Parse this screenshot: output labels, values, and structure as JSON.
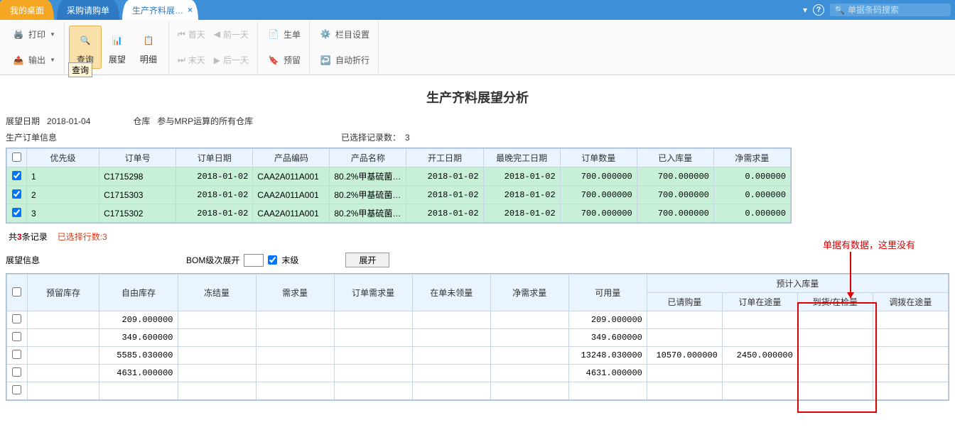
{
  "tabs": {
    "desktop": "我的桌面",
    "purchase": "采购请购单",
    "active": "生产齐料展…",
    "close": "×"
  },
  "titlebar": {
    "search_placeholder": "单据条码搜索",
    "help": "?",
    "dropdown": "▾"
  },
  "ribbon": {
    "print": "打印",
    "output": "输出",
    "query": "查询",
    "query_tip": "查询",
    "outlook": "展望",
    "detail": "明细",
    "firstday": "首天",
    "prevday": "前一天",
    "lastday": "末天",
    "nextday": "后一天",
    "makeorder": "生单",
    "reserve": "预留",
    "colset": "栏目设置",
    "wrap": "自动折行"
  },
  "page": {
    "title": "生产齐料展望分析",
    "date_label": "展望日期",
    "date_val": "2018-01-04",
    "wh_label": "仓库",
    "wh_val": "参与MRP运算的所有仓库",
    "order_info": "生产订单信息",
    "sel_label": "已选择记录数：",
    "sel_count": "3",
    "total_pre": "共",
    "total_n": "3",
    "total_suf": "条记录",
    "sel_rows": "已选择行数:3",
    "outlook_info": "展望信息",
    "bom_label": "BOM级次展开",
    "end_level": "末级",
    "expand_btn": "展开"
  },
  "t1": {
    "cols": [
      "优先级",
      "订单号",
      "订单日期",
      "产品编码",
      "产品名称",
      "开工日期",
      "最晚完工日期",
      "订单数量",
      "已入库量",
      "净需求量"
    ],
    "rows": [
      {
        "p": "1",
        "o": "C1715298",
        "d": "2018-01-02",
        "pc": "CAA2A011A001",
        "pn": "80.2%甲基硫菌…",
        "s": "2018-01-02",
        "e": "2018-01-02",
        "q": "700.000000",
        "in": "700.000000",
        "net": "0.000000"
      },
      {
        "p": "2",
        "o": "C1715303",
        "d": "2018-01-02",
        "pc": "CAA2A011A001",
        "pn": "80.2%甲基硫菌…",
        "s": "2018-01-02",
        "e": "2018-01-02",
        "q": "700.000000",
        "in": "700.000000",
        "net": "0.000000"
      },
      {
        "p": "3",
        "o": "C1715302",
        "d": "2018-01-02",
        "pc": "CAA2A011A001",
        "pn": "80.2%甲基硫菌…",
        "s": "2018-01-02",
        "e": "2018-01-02",
        "q": "700.000000",
        "in": "700.000000",
        "net": "0.000000"
      }
    ]
  },
  "t2": {
    "cols": [
      "预留库存",
      "自由库存",
      "冻结量",
      "需求量",
      "订单需求量",
      "在单未领量",
      "净需求量",
      "可用量"
    ],
    "group": "预计入库量",
    "subcols": [
      "已请购量",
      "订单在途量",
      "到货/在检量",
      "调拨在途量"
    ],
    "rows": [
      {
        "free": "209.000000",
        "avail": "209.000000"
      },
      {
        "free": "349.600000",
        "avail": "349.600000"
      },
      {
        "free": "5585.030000",
        "avail": "13248.030000",
        "req": "10570.000000",
        "otw": "2450.000000"
      },
      {
        "free": "4631.000000",
        "avail": "4631.000000"
      }
    ]
  },
  "annotation": "单据有数据，这里没有"
}
